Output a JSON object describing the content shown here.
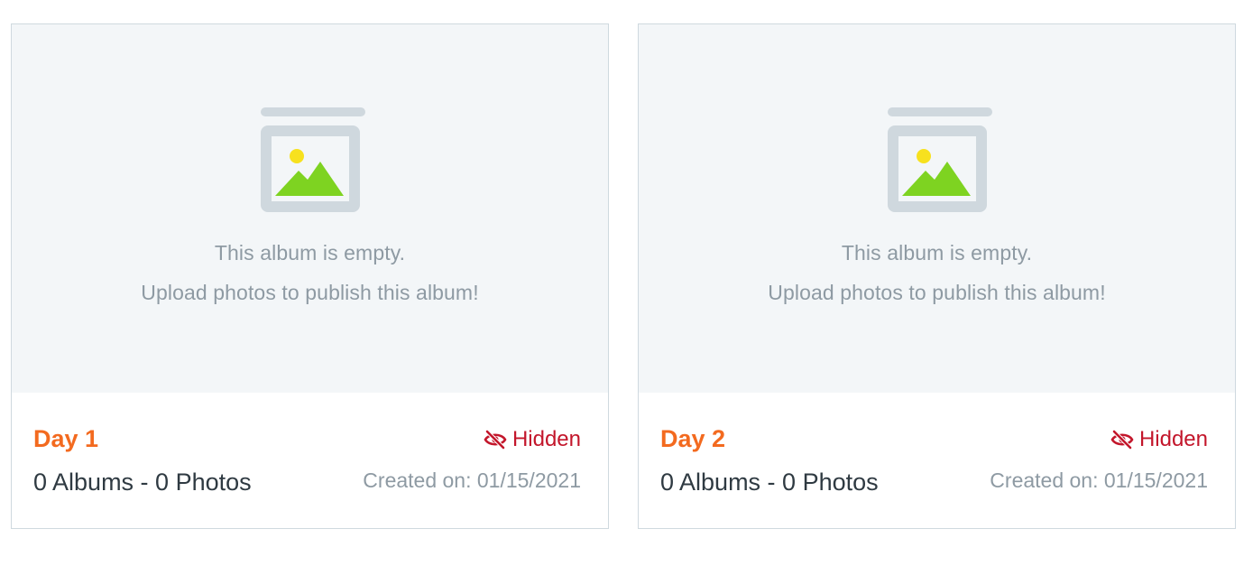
{
  "albums": [
    {
      "title": "Day 1",
      "empty_message": "This album is empty.",
      "empty_hint": "Upload photos to publish this album!",
      "counts": "0 Albums - 0 Photos",
      "visibility": "Hidden",
      "created": "Created on: 01/15/2021"
    },
    {
      "title": "Day 2",
      "empty_message": "This album is empty.",
      "empty_hint": "Upload photos to publish this album!",
      "counts": "0 Albums - 0 Photos",
      "visibility": "Hidden",
      "created": "Created on: 01/15/2021"
    }
  ],
  "colors": {
    "title": "#f36a1f",
    "hidden": "#c3162b",
    "muted": "#8e9aa3",
    "cover_bg": "#f3f6f8",
    "icon_frame": "#cfd8de",
    "sun": "#f7e11e",
    "mountain": "#7ed321"
  },
  "icons": {
    "cover": "empty-album-image-icon",
    "visibility": "eye-slash-icon"
  }
}
